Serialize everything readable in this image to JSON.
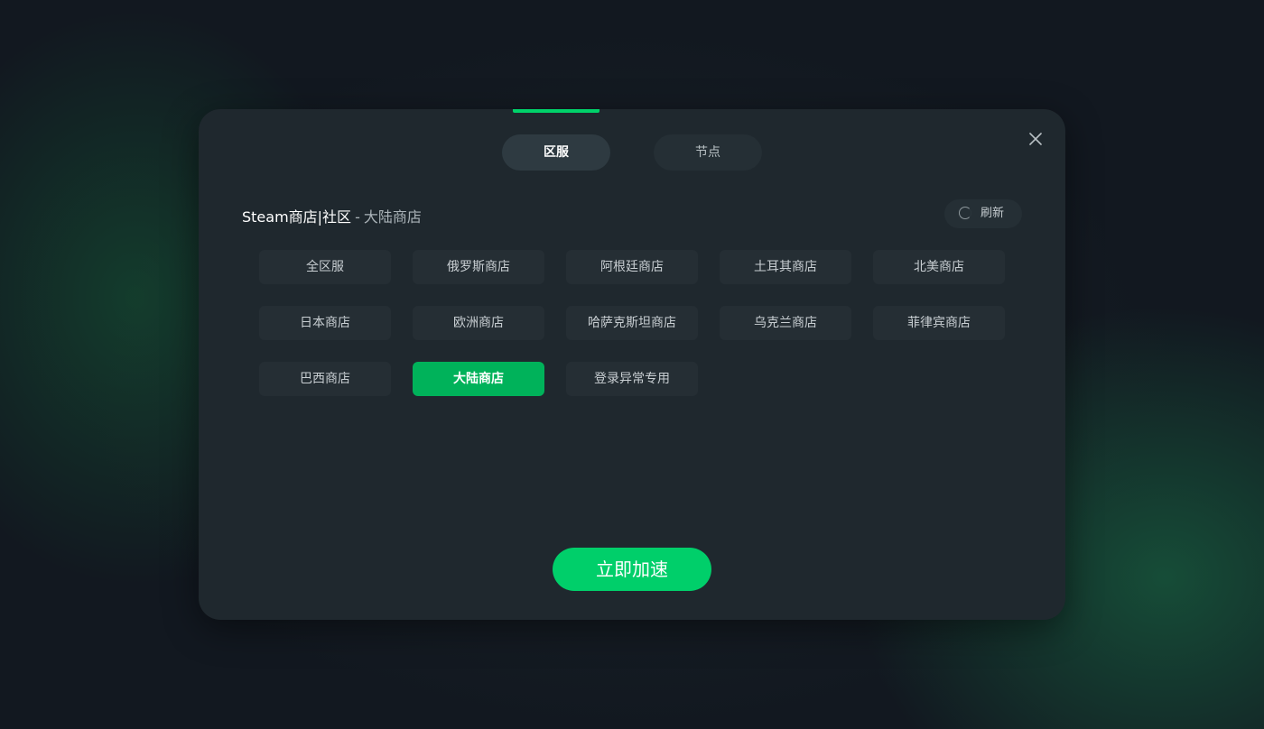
{
  "tabs": [
    {
      "label": "区服",
      "active": true
    },
    {
      "label": "节点",
      "active": false
    }
  ],
  "section": {
    "game": "Steam商店|社区",
    "separator": "-",
    "selected_region": "大陆商店"
  },
  "refresh": {
    "label": "刷新",
    "icon": "loading-spinner-icon"
  },
  "close": {
    "icon": "close-icon"
  },
  "regions": [
    {
      "label": "全区服",
      "active": false
    },
    {
      "label": "俄罗斯商店",
      "active": false
    },
    {
      "label": "阿根廷商店",
      "active": false
    },
    {
      "label": "土耳其商店",
      "active": false
    },
    {
      "label": "北美商店",
      "active": false
    },
    {
      "label": "日本商店",
      "active": false
    },
    {
      "label": "欧洲商店",
      "active": false
    },
    {
      "label": "哈萨克斯坦商店",
      "active": false
    },
    {
      "label": "乌克兰商店",
      "active": false
    },
    {
      "label": "菲律宾商店",
      "active": false
    },
    {
      "label": "巴西商店",
      "active": false
    },
    {
      "label": "大陆商店",
      "active": true
    },
    {
      "label": "登录异常专用",
      "active": false
    }
  ],
  "action": {
    "label": "立即加速"
  },
  "colors": {
    "accent": "#00d26a",
    "active_region": "#00b25a",
    "modal_bg": "#1f282e"
  }
}
